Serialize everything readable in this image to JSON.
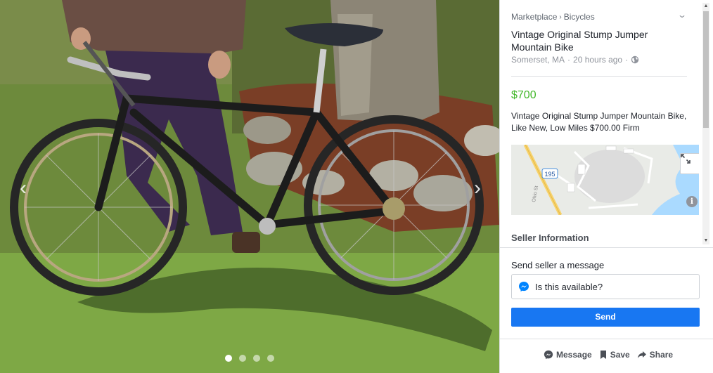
{
  "viewer": {
    "prev_glyph": "‹",
    "next_glyph": "›",
    "dots": 4,
    "active_dot": 0
  },
  "listing": {
    "breadcrumb": [
      "Marketplace",
      "Bicycles"
    ],
    "breadcrumb_separator": "›",
    "title": "Vintage Original Stump Jumper Mountain Bike",
    "location": "Somerset, MA",
    "separator": "·",
    "posted": "20 hours ago",
    "price": "$700",
    "description": "Vintage Original Stump Jumper Mountain Bike, Like New, Low Miles $700.00 Firm",
    "map_road_label": "195",
    "map_street_label": "Ohio St",
    "seller_heading": "Seller Information"
  },
  "message": {
    "heading": "Send seller a message",
    "input_value": "Is this available?",
    "send_label": "Send"
  },
  "actions": {
    "message_label": "Message",
    "save_label": "Save",
    "share_label": "Share"
  },
  "colors": {
    "price": "#42b72a",
    "send_button": "#1877f2",
    "messenger": "#0084ff"
  }
}
